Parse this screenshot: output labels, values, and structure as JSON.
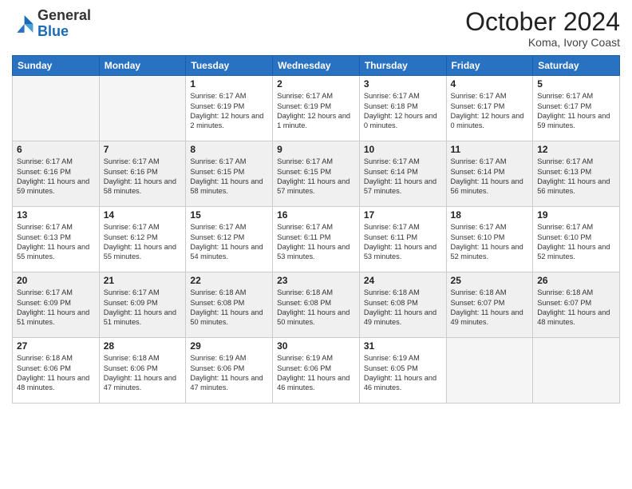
{
  "header": {
    "logo_line1": "General",
    "logo_line2": "Blue",
    "month": "October 2024",
    "location": "Koma, Ivory Coast"
  },
  "days_of_week": [
    "Sunday",
    "Monday",
    "Tuesday",
    "Wednesday",
    "Thursday",
    "Friday",
    "Saturday"
  ],
  "weeks": [
    [
      {
        "day": "",
        "text": ""
      },
      {
        "day": "",
        "text": ""
      },
      {
        "day": "1",
        "text": "Sunrise: 6:17 AM\nSunset: 6:19 PM\nDaylight: 12 hours\nand 2 minutes."
      },
      {
        "day": "2",
        "text": "Sunrise: 6:17 AM\nSunset: 6:19 PM\nDaylight: 12 hours\nand 1 minute."
      },
      {
        "day": "3",
        "text": "Sunrise: 6:17 AM\nSunset: 6:18 PM\nDaylight: 12 hours\nand 0 minutes."
      },
      {
        "day": "4",
        "text": "Sunrise: 6:17 AM\nSunset: 6:17 PM\nDaylight: 12 hours\nand 0 minutes."
      },
      {
        "day": "5",
        "text": "Sunrise: 6:17 AM\nSunset: 6:17 PM\nDaylight: 11 hours\nand 59 minutes."
      }
    ],
    [
      {
        "day": "6",
        "text": "Sunrise: 6:17 AM\nSunset: 6:16 PM\nDaylight: 11 hours\nand 59 minutes."
      },
      {
        "day": "7",
        "text": "Sunrise: 6:17 AM\nSunset: 6:16 PM\nDaylight: 11 hours\nand 58 minutes."
      },
      {
        "day": "8",
        "text": "Sunrise: 6:17 AM\nSunset: 6:15 PM\nDaylight: 11 hours\nand 58 minutes."
      },
      {
        "day": "9",
        "text": "Sunrise: 6:17 AM\nSunset: 6:15 PM\nDaylight: 11 hours\nand 57 minutes."
      },
      {
        "day": "10",
        "text": "Sunrise: 6:17 AM\nSunset: 6:14 PM\nDaylight: 11 hours\nand 57 minutes."
      },
      {
        "day": "11",
        "text": "Sunrise: 6:17 AM\nSunset: 6:14 PM\nDaylight: 11 hours\nand 56 minutes."
      },
      {
        "day": "12",
        "text": "Sunrise: 6:17 AM\nSunset: 6:13 PM\nDaylight: 11 hours\nand 56 minutes."
      }
    ],
    [
      {
        "day": "13",
        "text": "Sunrise: 6:17 AM\nSunset: 6:13 PM\nDaylight: 11 hours\nand 55 minutes."
      },
      {
        "day": "14",
        "text": "Sunrise: 6:17 AM\nSunset: 6:12 PM\nDaylight: 11 hours\nand 55 minutes."
      },
      {
        "day": "15",
        "text": "Sunrise: 6:17 AM\nSunset: 6:12 PM\nDaylight: 11 hours\nand 54 minutes."
      },
      {
        "day": "16",
        "text": "Sunrise: 6:17 AM\nSunset: 6:11 PM\nDaylight: 11 hours\nand 53 minutes."
      },
      {
        "day": "17",
        "text": "Sunrise: 6:17 AM\nSunset: 6:11 PM\nDaylight: 11 hours\nand 53 minutes."
      },
      {
        "day": "18",
        "text": "Sunrise: 6:17 AM\nSunset: 6:10 PM\nDaylight: 11 hours\nand 52 minutes."
      },
      {
        "day": "19",
        "text": "Sunrise: 6:17 AM\nSunset: 6:10 PM\nDaylight: 11 hours\nand 52 minutes."
      }
    ],
    [
      {
        "day": "20",
        "text": "Sunrise: 6:17 AM\nSunset: 6:09 PM\nDaylight: 11 hours\nand 51 minutes."
      },
      {
        "day": "21",
        "text": "Sunrise: 6:17 AM\nSunset: 6:09 PM\nDaylight: 11 hours\nand 51 minutes."
      },
      {
        "day": "22",
        "text": "Sunrise: 6:18 AM\nSunset: 6:08 PM\nDaylight: 11 hours\nand 50 minutes."
      },
      {
        "day": "23",
        "text": "Sunrise: 6:18 AM\nSunset: 6:08 PM\nDaylight: 11 hours\nand 50 minutes."
      },
      {
        "day": "24",
        "text": "Sunrise: 6:18 AM\nSunset: 6:08 PM\nDaylight: 11 hours\nand 49 minutes."
      },
      {
        "day": "25",
        "text": "Sunrise: 6:18 AM\nSunset: 6:07 PM\nDaylight: 11 hours\nand 49 minutes."
      },
      {
        "day": "26",
        "text": "Sunrise: 6:18 AM\nSunset: 6:07 PM\nDaylight: 11 hours\nand 48 minutes."
      }
    ],
    [
      {
        "day": "27",
        "text": "Sunrise: 6:18 AM\nSunset: 6:06 PM\nDaylight: 11 hours\nand 48 minutes."
      },
      {
        "day": "28",
        "text": "Sunrise: 6:18 AM\nSunset: 6:06 PM\nDaylight: 11 hours\nand 47 minutes."
      },
      {
        "day": "29",
        "text": "Sunrise: 6:19 AM\nSunset: 6:06 PM\nDaylight: 11 hours\nand 47 minutes."
      },
      {
        "day": "30",
        "text": "Sunrise: 6:19 AM\nSunset: 6:06 PM\nDaylight: 11 hours\nand 46 minutes."
      },
      {
        "day": "31",
        "text": "Sunrise: 6:19 AM\nSunset: 6:05 PM\nDaylight: 11 hours\nand 46 minutes."
      },
      {
        "day": "",
        "text": ""
      },
      {
        "day": "",
        "text": ""
      }
    ]
  ]
}
